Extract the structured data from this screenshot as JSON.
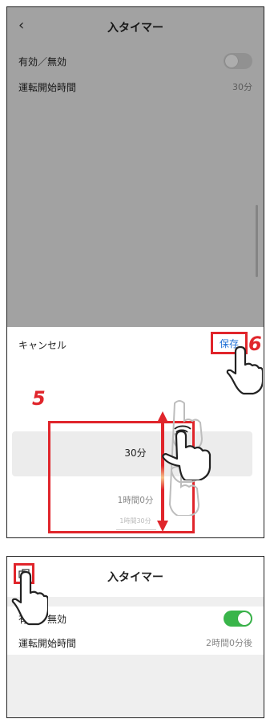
{
  "screen1": {
    "header": {
      "title": "入タイマー",
      "back_icon": "chevron-left-icon"
    },
    "rows": [
      {
        "label": "有効／無効",
        "toggle": "off"
      },
      {
        "label": "運転開始時間",
        "value": "30分"
      }
    ],
    "sheet": {
      "cancel_label": "キャンセル",
      "save_label": "保存",
      "picker_items": [
        "30分",
        "1時間0分",
        "1時間30分"
      ],
      "selected_index": 0
    },
    "annotations": {
      "step_swipe": "5",
      "step_save": "6"
    }
  },
  "screen2": {
    "header": {
      "title": "入タイマー",
      "home_icon": "device-icon"
    },
    "rows": [
      {
        "label": "有効／無効",
        "toggle": "on"
      },
      {
        "label": "運転開始時間",
        "value": "2時間0分後"
      }
    ]
  },
  "colors": {
    "accent_red": "#e0252b",
    "link_blue": "#1d6fd6",
    "toggle_on": "#39b54a"
  }
}
